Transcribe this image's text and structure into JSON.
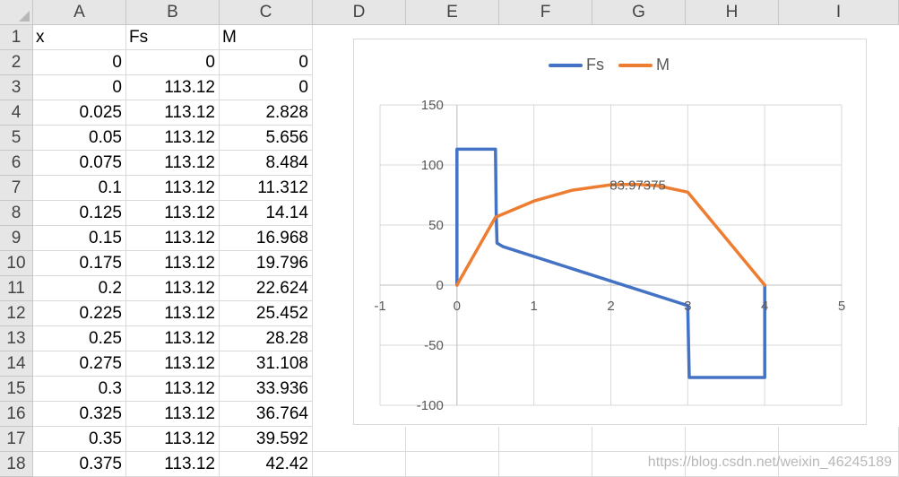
{
  "spreadsheet": {
    "columns": [
      "A",
      "B",
      "C",
      "D",
      "E",
      "F",
      "G",
      "H",
      "I"
    ],
    "rows": [
      "1",
      "2",
      "3",
      "4",
      "5",
      "6",
      "7",
      "8",
      "9",
      "10",
      "11",
      "12",
      "13",
      "14",
      "15",
      "16",
      "17",
      "18"
    ],
    "header_row": {
      "A": "x",
      "B": "Fs",
      "C": "M"
    },
    "data": [
      [
        "0",
        "0",
        "0"
      ],
      [
        "0",
        "113.12",
        "0"
      ],
      [
        "0.025",
        "113.12",
        "2.828"
      ],
      [
        "0.05",
        "113.12",
        "5.656"
      ],
      [
        "0.075",
        "113.12",
        "8.484"
      ],
      [
        "0.1",
        "113.12",
        "11.312"
      ],
      [
        "0.125",
        "113.12",
        "14.14"
      ],
      [
        "0.15",
        "113.12",
        "16.968"
      ],
      [
        "0.175",
        "113.12",
        "19.796"
      ],
      [
        "0.2",
        "113.12",
        "22.624"
      ],
      [
        "0.225",
        "113.12",
        "25.452"
      ],
      [
        "0.25",
        "113.12",
        "28.28"
      ],
      [
        "0.275",
        "113.12",
        "31.108"
      ],
      [
        "0.3",
        "113.12",
        "33.936"
      ],
      [
        "0.325",
        "113.12",
        "36.764"
      ],
      [
        "0.35",
        "113.12",
        "39.592"
      ],
      [
        "0.375",
        "113.12",
        "42.42"
      ]
    ]
  },
  "chart_data": {
    "type": "scatter",
    "xlim": [
      -1,
      5
    ],
    "ylim": [
      -100,
      150
    ],
    "x_ticks": [
      "-1",
      "0",
      "1",
      "2",
      "3",
      "4",
      "5"
    ],
    "y_ticks": [
      "150",
      "100",
      "50",
      "0",
      "-50",
      "-100"
    ],
    "legend_position": "top",
    "grid": true,
    "annotation": "83.97375",
    "series": [
      {
        "name": "Fs",
        "color": "#4472C4",
        "points": [
          [
            0,
            0
          ],
          [
            0,
            113.12
          ],
          [
            0.5,
            113.12
          ],
          [
            0.51,
            60
          ],
          [
            0.52,
            35
          ],
          [
            0.6,
            32
          ],
          [
            3,
            -17
          ],
          [
            3.01,
            -50
          ],
          [
            3.02,
            -76.88
          ],
          [
            4,
            -76.88
          ],
          [
            4,
            0
          ]
        ]
      },
      {
        "name": "M",
        "color": "#ED7D31",
        "points": [
          [
            0,
            0
          ],
          [
            0.5,
            56.56
          ],
          [
            1,
            70
          ],
          [
            1.5,
            79
          ],
          [
            2,
            83.5
          ],
          [
            2.3,
            83.97
          ],
          [
            2.6,
            82.8
          ],
          [
            3,
            77.4
          ],
          [
            4,
            0
          ]
        ]
      }
    ]
  },
  "watermark": "https://blog.csdn.net/weixin_46245189"
}
